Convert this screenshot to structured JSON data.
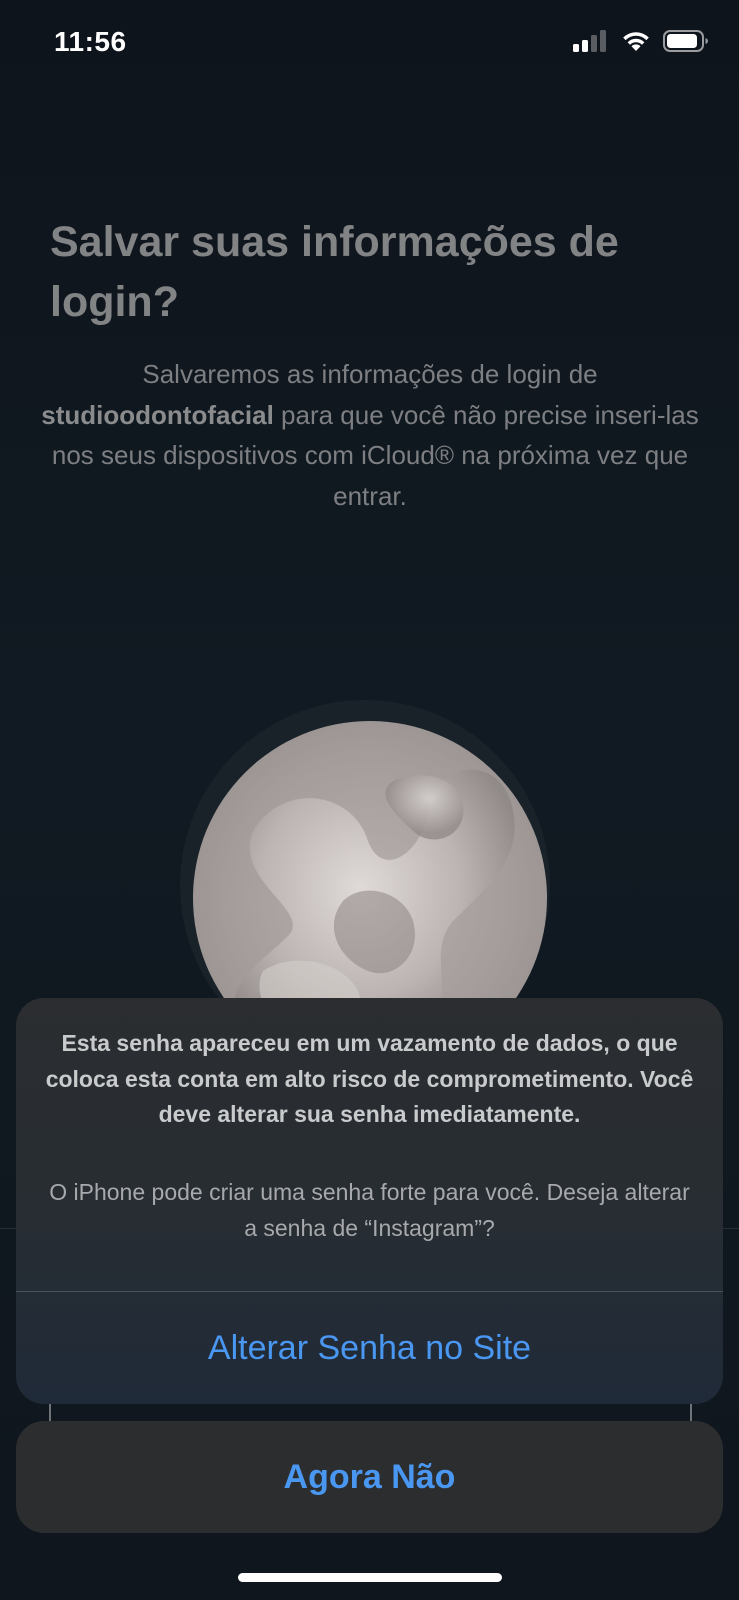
{
  "status_bar": {
    "time": "11:56",
    "icons": [
      "cellular-signal-icon",
      "wifi-icon",
      "battery-icon"
    ]
  },
  "background_page": {
    "title": "Salvar suas informações de login?",
    "description_prefix": "Salvaremos as informações de login de",
    "username": "studioodontofacial",
    "description_suffix": "para que você não precise inseri-las nos seus dispositivos com iCloud® na próxima vez que entrar."
  },
  "alert": {
    "message": "Esta senha apareceu em um vazamento de dados, o que coloca esta conta em alto risco de comprometimento. Você deve alterar sua senha imediatamente.",
    "subtext": "O iPhone pode criar uma senha forte para você. Deseja alterar a senha de “Instagram”?",
    "action_label": "Alterar Senha no Site",
    "cancel_label": "Agora Não"
  },
  "colors": {
    "accent": "#4a97f2",
    "background": "#0f151c",
    "alert_background": "#2b2d30",
    "cancel_background": "#2c2d2f"
  }
}
